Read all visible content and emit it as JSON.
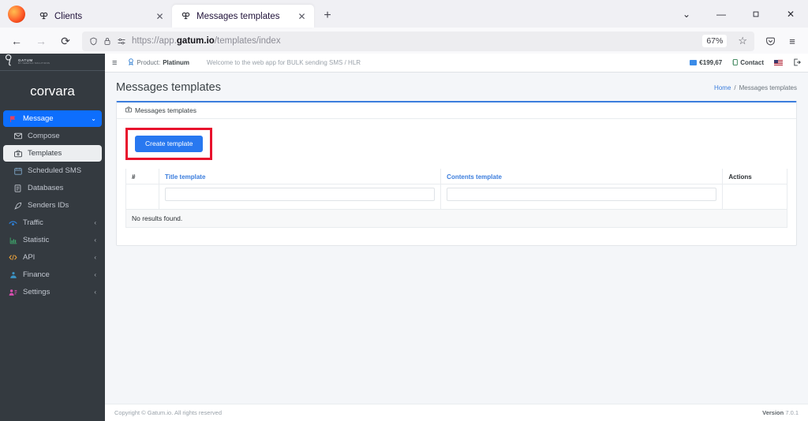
{
  "browser": {
    "tabs": [
      {
        "title": "Clients",
        "favicon": "gatum-icon",
        "active": false
      },
      {
        "title": "Messages templates",
        "favicon": "gatum-icon",
        "active": true
      }
    ],
    "new_tab_label": "+",
    "tab_list_label": "⌄",
    "window_controls": {
      "minimize": "—",
      "maximize": "❐",
      "close": "✕"
    },
    "nav": {
      "back": "←",
      "forward": "→",
      "reload": "⟳",
      "shield_icon": "shield-icon",
      "lock_icon": "lock-icon",
      "tracking_icon": "permissions-icon",
      "url_prefix": "https://app.",
      "url_domain": "gatum.io",
      "url_path": "/templates/index",
      "zoom_level": "67%",
      "bookmark_icon": "☆",
      "pocket_icon": "save-to-pocket-icon",
      "menu_icon": "≡"
    }
  },
  "sidebar": {
    "logo_name": "GATUM",
    "logo_sub": "BY SEMPCO SOLUTIONS",
    "account": "corvara",
    "items": [
      {
        "label": "Message",
        "icon": "message-icon",
        "caret": "⌄",
        "state": "primary"
      },
      {
        "label": "Compose",
        "icon": "envelope-icon",
        "caret": "",
        "state": "sub"
      },
      {
        "label": "Templates",
        "icon": "template-icon",
        "caret": "",
        "state": "active"
      },
      {
        "label": "Scheduled SMS",
        "icon": "calendar-icon",
        "caret": "",
        "state": "sub"
      },
      {
        "label": "Databases",
        "icon": "database-icon",
        "caret": "",
        "state": "sub"
      },
      {
        "label": "Senders IDs",
        "icon": "feather-icon",
        "caret": "",
        "state": "sub"
      },
      {
        "label": "Traffic",
        "icon": "traffic-icon",
        "caret": "‹",
        "state": "top"
      },
      {
        "label": "Statistic",
        "icon": "chart-icon",
        "caret": "‹",
        "state": "top"
      },
      {
        "label": "API",
        "icon": "code-icon",
        "caret": "‹",
        "state": "top"
      },
      {
        "label": "Finance",
        "icon": "finance-icon",
        "caret": "‹",
        "state": "top"
      },
      {
        "label": "Settings",
        "icon": "settings-icon",
        "caret": "‹",
        "state": "top"
      }
    ]
  },
  "topbar": {
    "menu_toggle": "≡",
    "product_label": "Product:",
    "product_value": "Platinum",
    "welcome": "Welcome to the web app for BULK sending SMS / HLR",
    "balance": "€199,67",
    "contact": "Contact",
    "language_icon": "us-flag-icon",
    "logout_icon": "logout-icon"
  },
  "page": {
    "title": "Messages templates",
    "breadcrumb_home": "Home",
    "breadcrumb_sep": "/",
    "breadcrumb_current": "Messages templates"
  },
  "card": {
    "header_icon": "template-icon",
    "header_title": "Messages templates",
    "create_button": "Create template",
    "highlight_color": "#e8112d"
  },
  "table": {
    "columns": [
      {
        "label": "#",
        "type": "plain",
        "filter": false
      },
      {
        "label": "Title template",
        "type": "link",
        "filter": true
      },
      {
        "label": "Contents template",
        "type": "link",
        "filter": true
      },
      {
        "label": "Actions",
        "type": "plain",
        "filter": false
      }
    ],
    "empty_message": "No results found.",
    "rows": []
  },
  "footer": {
    "copyright": "Copyright © Gatum.io. All rights reserved",
    "version_label": "Version",
    "version_value": "7.0.1"
  },
  "colors": {
    "accent_blue": "#3b7ddd",
    "button_blue": "#2878f0",
    "sidebar_bg": "#343a40",
    "highlight_red": "#e8112d"
  }
}
